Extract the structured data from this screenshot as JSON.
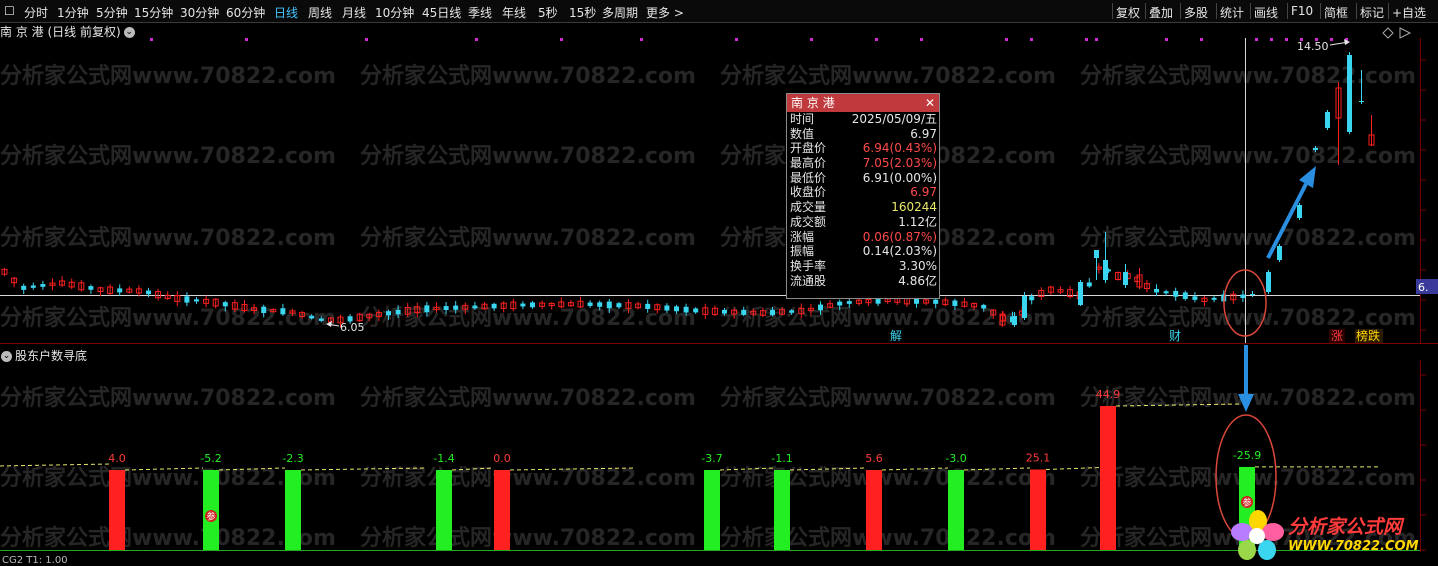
{
  "toolbar": {
    "periods": [
      "分时",
      "1分钟",
      "5分钟",
      "15分钟",
      "30分钟",
      "60分钟",
      "日线",
      "周线",
      "月线",
      "10分钟",
      "45日线",
      "季线",
      "年线",
      "5秒",
      "15秒",
      "多周期",
      "更多 >"
    ],
    "active_period": "日线",
    "right_items": [
      "复权",
      "叠加",
      "多股",
      "统计",
      "画线",
      "F10",
      "简框",
      "标记",
      "+自选"
    ]
  },
  "chart": {
    "title": "南 京 港 (日线 前复权)",
    "high_label": "14.50",
    "low_label": "6.05",
    "price_edge_label": "6.",
    "event_labels": [
      "解",
      "财",
      "涨",
      "榜跌"
    ]
  },
  "watermark": "分析家公式网www.70822.com",
  "popup": {
    "title": "南 京 港",
    "rows": [
      {
        "label": "时间",
        "value": "2025/05/09/五",
        "color": "white"
      },
      {
        "label": "数值",
        "value": "6.97",
        "color": "white"
      },
      {
        "label": "开盘价",
        "value": "6.94(0.43%)",
        "color": "red"
      },
      {
        "label": "最高价",
        "value": "7.05(2.03%)",
        "color": "red"
      },
      {
        "label": "最低价",
        "value": "6.91(0.00%)",
        "color": "white"
      },
      {
        "label": "收盘价",
        "value": "6.97",
        "color": "red"
      },
      {
        "label": "成交量",
        "value": "160244",
        "color": "yellow"
      },
      {
        "label": "成交额",
        "value": "1.12亿",
        "color": "white"
      },
      {
        "label": "涨幅",
        "value": "0.06(0.87%)",
        "color": "red"
      },
      {
        "label": "振幅",
        "value": "0.14(2.03%)",
        "color": "white"
      },
      {
        "label": "换手率",
        "value": "3.30%",
        "color": "white"
      },
      {
        "label": "流通股",
        "value": "4.86亿",
        "color": "white"
      }
    ]
  },
  "indicator": {
    "title": "股东户数寻底",
    "bars": [
      {
        "label": "4.0",
        "value": 4.0
      },
      {
        "label": "-5.2",
        "value": -5.2
      },
      {
        "label": "-2.3",
        "value": -2.3
      },
      {
        "label": "-1.4",
        "value": -1.4
      },
      {
        "label": "0.0",
        "value": 0.0
      },
      {
        "label": "-3.7",
        "value": -3.7
      },
      {
        "label": "-1.1",
        "value": -1.1
      },
      {
        "label": "5.6",
        "value": 5.6
      },
      {
        "label": "-3.0",
        "value": -3.0
      },
      {
        "label": "25.1",
        "value": 25.1
      },
      {
        "label": "44.9",
        "value": 44.9
      },
      {
        "label": "-25.9",
        "value": -25.9
      }
    ],
    "badges": [
      "参",
      "参"
    ]
  },
  "logo": {
    "line1": "分析家公式网",
    "line2": "WWW.70822.COM"
  },
  "status": "CG2 T1: 1.00",
  "colors": {
    "up": "#ff2020",
    "down": "#22ee22",
    "candle_down": "#3ad6f0",
    "accent": "#41c6ff",
    "annotation": "#d9473a",
    "arrow": "#2a8fe0"
  }
}
